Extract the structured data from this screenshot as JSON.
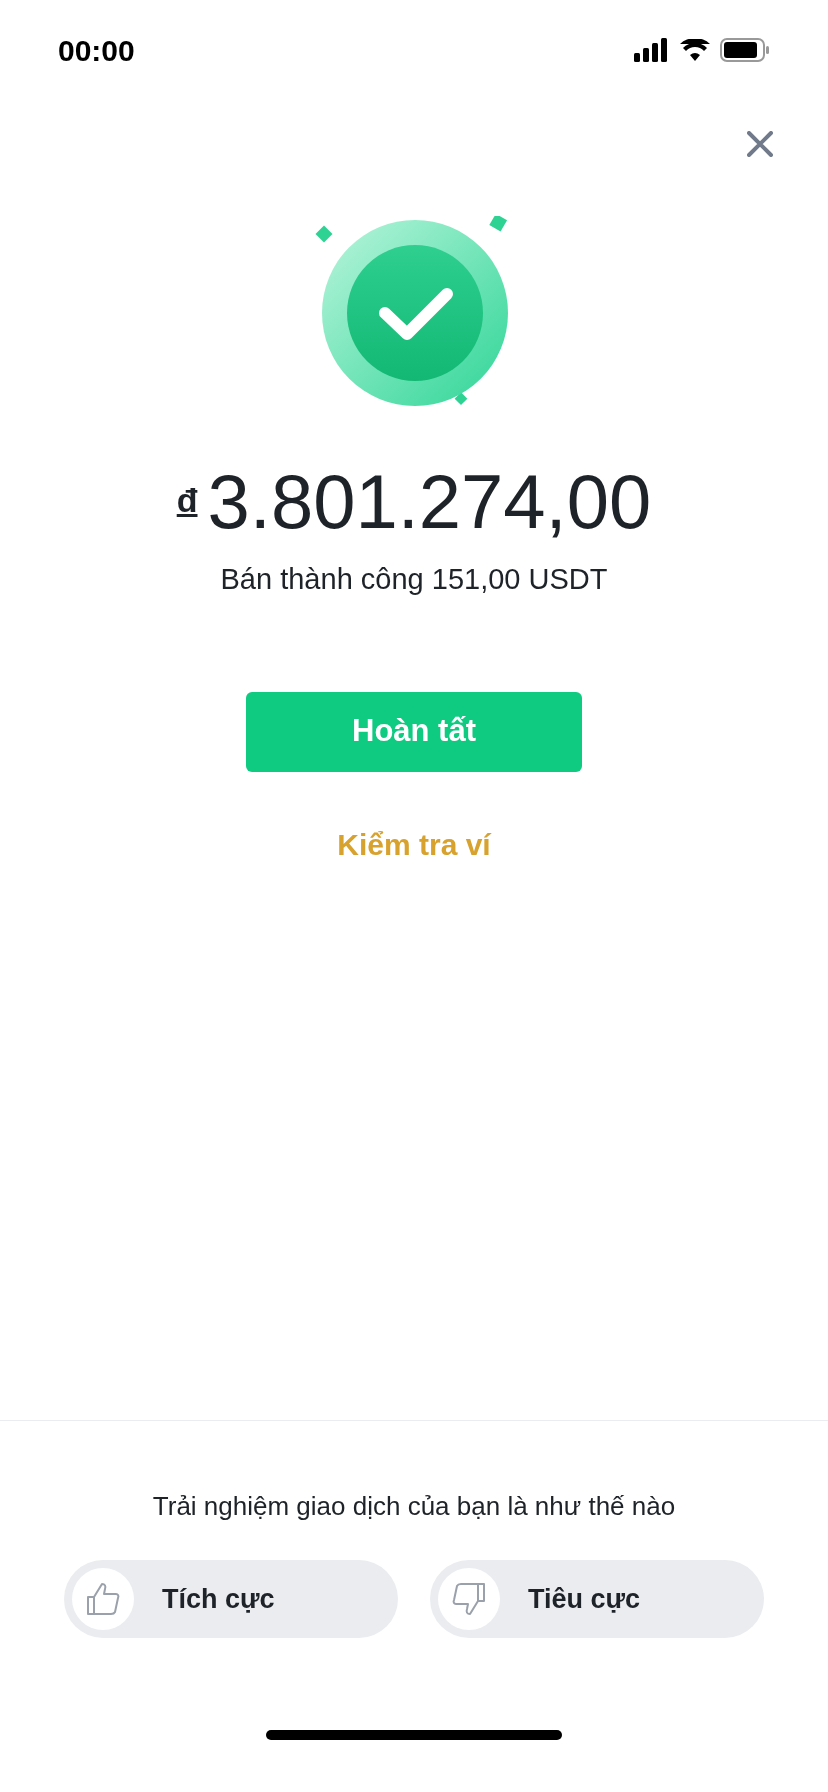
{
  "status_bar": {
    "time": "00:00"
  },
  "result": {
    "currency": "đ",
    "amount": "3.801.274,00",
    "message": "Bán thành công 151,00 USDT"
  },
  "primary_button": {
    "label": "Hoàn tất"
  },
  "link": {
    "label": "Kiểm tra ví"
  },
  "feedback": {
    "question": "Trải nghiệm giao dịch của bạn là như thế nào",
    "options": [
      {
        "kind": "positive",
        "label": "Tích cực"
      },
      {
        "kind": "negative",
        "label": "Tiêu cực"
      }
    ]
  }
}
